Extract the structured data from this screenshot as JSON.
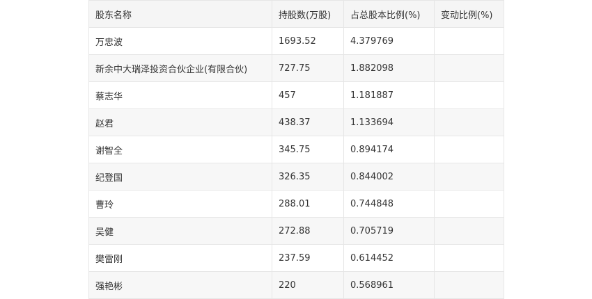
{
  "table": {
    "headers": [
      "股东名称",
      "持股数(万股)",
      "占总股本比例(%)",
      "变动比例(%)"
    ],
    "rows": [
      {
        "name": "万忠波",
        "shares": "1693.52",
        "ratio": "4.379769",
        "change": ""
      },
      {
        "name": "新余中大瑞泽投资合伙企业(有限合伙)",
        "shares": "727.75",
        "ratio": "1.882098",
        "change": ""
      },
      {
        "name": "蔡志华",
        "shares": "457",
        "ratio": "1.181887",
        "change": ""
      },
      {
        "name": "赵君",
        "shares": "438.37",
        "ratio": "1.133694",
        "change": ""
      },
      {
        "name": "谢智全",
        "shares": "345.75",
        "ratio": "0.894174",
        "change": ""
      },
      {
        "name": "纪登国",
        "shares": "326.35",
        "ratio": "0.844002",
        "change": ""
      },
      {
        "name": "曹玲",
        "shares": "288.01",
        "ratio": "0.744848",
        "change": ""
      },
      {
        "name": "吴健",
        "shares": "272.88",
        "ratio": "0.705719",
        "change": ""
      },
      {
        "name": "樊雷刚",
        "shares": "237.59",
        "ratio": "0.614452",
        "change": ""
      },
      {
        "name": "强艳彬",
        "shares": "220",
        "ratio": "0.568961",
        "change": ""
      }
    ]
  }
}
